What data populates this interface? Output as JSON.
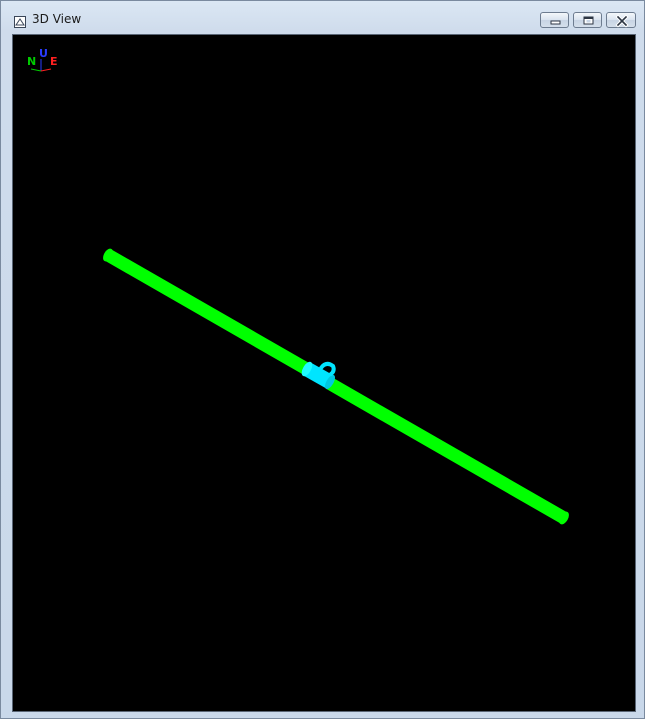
{
  "window": {
    "title": "3D View",
    "icon": "3d-view-app-icon",
    "controls": {
      "minimize": "minimize-icon",
      "restore": "restore-icon",
      "close": "close-icon"
    }
  },
  "viewport": {
    "background": "#000000",
    "axis_gizmo": {
      "north_label": "N",
      "up_label": "U",
      "east_label": "E",
      "north_color": "#00cc00",
      "up_color": "#2a3cff",
      "east_color": "#ff2020"
    },
    "objects": [
      {
        "type": "pipe",
        "color": "#00ff00"
      },
      {
        "type": "pipe-fitting",
        "color": "#00e5ff"
      },
      {
        "type": "pipe",
        "color": "#00ff00"
      }
    ]
  }
}
